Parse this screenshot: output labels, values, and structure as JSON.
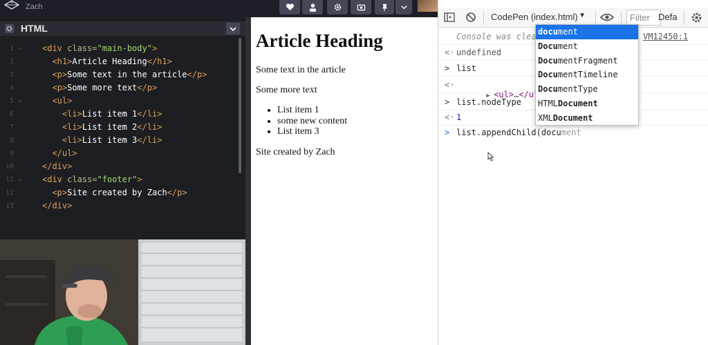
{
  "codepen": {
    "author": "Zach",
    "colors": {
      "topbar": "#1e1f26",
      "editor_bg": "#1d1e22",
      "tag": "#dda15b",
      "attr": "#b8bb8a",
      "string": "#a5d86e"
    }
  },
  "editor": {
    "title": "HTML",
    "lines": [
      {
        "num": "1",
        "fold": "▾",
        "segs": [
          [
            "tag",
            "<div "
          ],
          [
            "attr",
            "class="
          ],
          [
            "str",
            "\"main-body\""
          ],
          [
            "tag",
            ">"
          ]
        ]
      },
      {
        "num": "2",
        "fold": "",
        "segs": [
          [
            "txt",
            "  "
          ],
          [
            "tag",
            "<h1>"
          ],
          [
            "txt",
            "Article Heading"
          ],
          [
            "tag",
            "</h1>"
          ]
        ]
      },
      {
        "num": "3",
        "fold": "",
        "segs": [
          [
            "txt",
            "  "
          ],
          [
            "tag",
            "<p>"
          ],
          [
            "txt",
            "Some text in the article"
          ],
          [
            "tag",
            "</p>"
          ]
        ]
      },
      {
        "num": "4",
        "fold": "",
        "segs": [
          [
            "txt",
            "  "
          ],
          [
            "tag",
            "<p>"
          ],
          [
            "txt",
            "Some more text"
          ],
          [
            "tag",
            "</p>"
          ]
        ]
      },
      {
        "num": "5",
        "fold": "▾",
        "segs": [
          [
            "txt",
            "  "
          ],
          [
            "tag",
            "<ul>"
          ]
        ]
      },
      {
        "num": "6",
        "fold": "",
        "segs": [
          [
            "txt",
            "    "
          ],
          [
            "tag",
            "<li>"
          ],
          [
            "txt",
            "List item 1"
          ],
          [
            "tag",
            "</li>"
          ]
        ]
      },
      {
        "num": "7",
        "fold": "",
        "segs": [
          [
            "txt",
            "    "
          ],
          [
            "tag",
            "<li>"
          ],
          [
            "txt",
            "List item 2"
          ],
          [
            "tag",
            "</li>"
          ]
        ]
      },
      {
        "num": "8",
        "fold": "",
        "segs": [
          [
            "txt",
            "    "
          ],
          [
            "tag",
            "<li>"
          ],
          [
            "txt",
            "List item 3"
          ],
          [
            "tag",
            "</li>"
          ]
        ]
      },
      {
        "num": "9",
        "fold": "",
        "segs": [
          [
            "txt",
            "  "
          ],
          [
            "tag",
            "</ul>"
          ]
        ]
      },
      {
        "num": "10",
        "fold": "",
        "segs": [
          [
            "tag",
            "</div>"
          ]
        ]
      },
      {
        "num": "11",
        "fold": "▾",
        "segs": [
          [
            "tag",
            "<div "
          ],
          [
            "attr",
            "class="
          ],
          [
            "str",
            "\"footer\""
          ],
          [
            "tag",
            ">"
          ]
        ]
      },
      {
        "num": "12",
        "fold": "",
        "segs": [
          [
            "txt",
            "  "
          ],
          [
            "tag",
            "<p>"
          ],
          [
            "txt",
            "Site created by Zach"
          ],
          [
            "tag",
            "</p>"
          ]
        ]
      },
      {
        "num": "13",
        "fold": "",
        "segs": [
          [
            "tag",
            "</div>"
          ]
        ]
      }
    ]
  },
  "preview": {
    "heading": "Article Heading",
    "para1": "Some text in the article",
    "para2": "Some more text",
    "list": [
      "List item 1",
      "some new content",
      "List item 3"
    ],
    "footer": "Site created by Zach"
  },
  "devtools": {
    "context": "CodePen (index.html)",
    "filter_placeholder": "Filter",
    "levels": "Defa",
    "console": {
      "cleared": "Console was clea",
      "cleared_link": "VM12450:1",
      "r1": "undefined",
      "c2": "list",
      "r2_open": "<ul>",
      "r2_dots": "…",
      "r2_close": "</ul>",
      "c3": "list.nodeType",
      "r3": "1",
      "c4_typed": "list.appendChild(docu",
      "c4_hint": "ment"
    },
    "autocomplete": [
      {
        "match": "docu",
        "rest": "ment",
        "prefix": "",
        "selected": true
      },
      {
        "match": "Docu",
        "rest": "ment",
        "prefix": "",
        "selected": false
      },
      {
        "match": "Docu",
        "rest": "mentFragment",
        "prefix": "",
        "selected": false
      },
      {
        "match": "Docu",
        "rest": "mentTimeline",
        "prefix": "",
        "selected": false
      },
      {
        "match": "Docu",
        "rest": "mentType",
        "prefix": "",
        "selected": false
      },
      {
        "match": "Document",
        "rest": "",
        "prefix": "HTML",
        "selected": false
      },
      {
        "match": "Document",
        "rest": "",
        "prefix": "XML",
        "selected": false
      }
    ]
  }
}
